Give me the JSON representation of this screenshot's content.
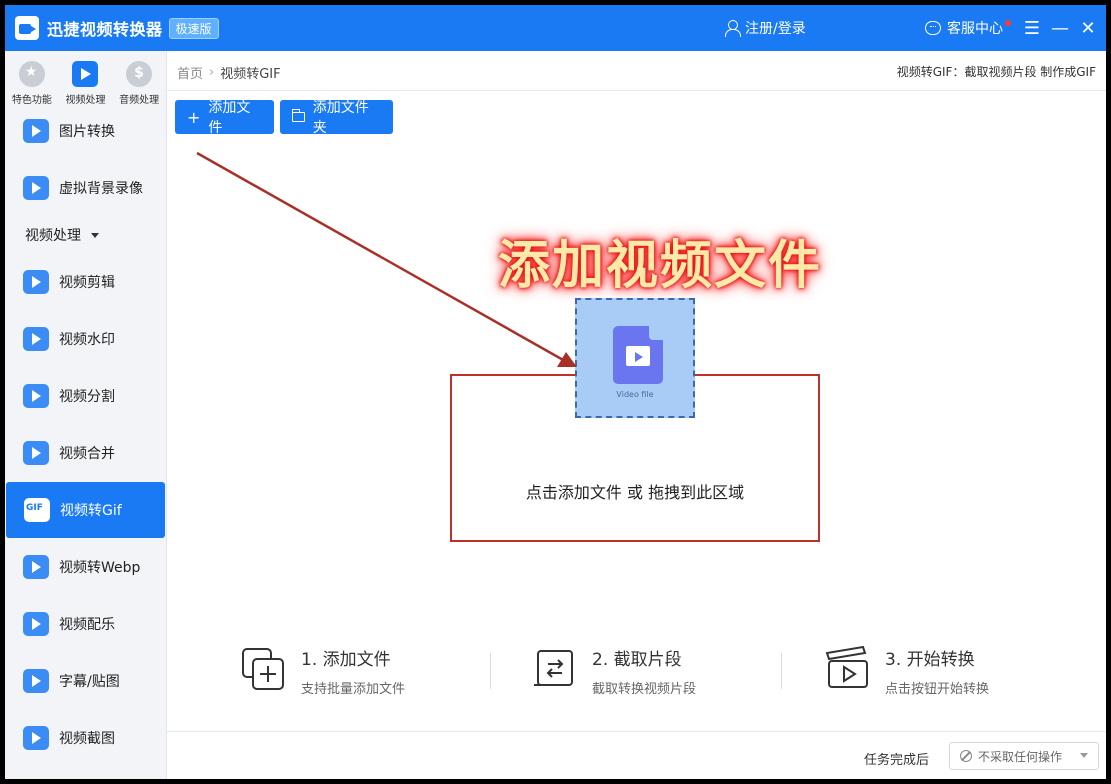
{
  "app": {
    "title": "迅捷视频转换器",
    "badge": "极速版",
    "login": "注册/登录",
    "support": "客服中心",
    "menu_glyph": "☰",
    "minimize_glyph": "—",
    "close_glyph": "✕"
  },
  "sidebar": {
    "tabs": [
      {
        "label": "特色功能",
        "icon": "star-icon"
      },
      {
        "label": "视频处理",
        "icon": "film-icon"
      },
      {
        "label": "音频处理",
        "icon": "audio-icon"
      }
    ],
    "items_top": [
      {
        "label": "图片转换"
      },
      {
        "label": "虚拟背景录像"
      }
    ],
    "section": "视频处理",
    "items": [
      {
        "label": "视频剪辑"
      },
      {
        "label": "视频水印"
      },
      {
        "label": "视频分割"
      },
      {
        "label": "视频合并"
      },
      {
        "label": "视频转Gif"
      },
      {
        "label": "视频转Webp"
      },
      {
        "label": "视频配乐"
      },
      {
        "label": "字幕/贴图"
      },
      {
        "label": "视频截图"
      }
    ],
    "active_item": "视频转Gif"
  },
  "main": {
    "breadcrumb": {
      "home": "首页",
      "sep": "›",
      "current": "视频转GIF"
    },
    "hint": "视频转GIF：截取视频片段 制作成GIF",
    "add_file": "添加文件",
    "add_folder": "添加文件夹",
    "overlay_label": "添加视频文件",
    "file_icon_label": "Video file",
    "drop_text": "点击添加文件 或 拖拽到此区域",
    "steps": [
      {
        "title": "1. 添加文件",
        "sub": "支持批量添加文件"
      },
      {
        "title": "2. 截取片段",
        "sub": "截取转换视频片段"
      },
      {
        "title": "3. 开始转换",
        "sub": "点击按钮开始转换"
      }
    ]
  },
  "footer": {
    "after_label": "任务完成后",
    "after_value": "不采取任何操作"
  },
  "colors": {
    "accent": "#1a7af3",
    "annotation_red": "#c0302a"
  }
}
